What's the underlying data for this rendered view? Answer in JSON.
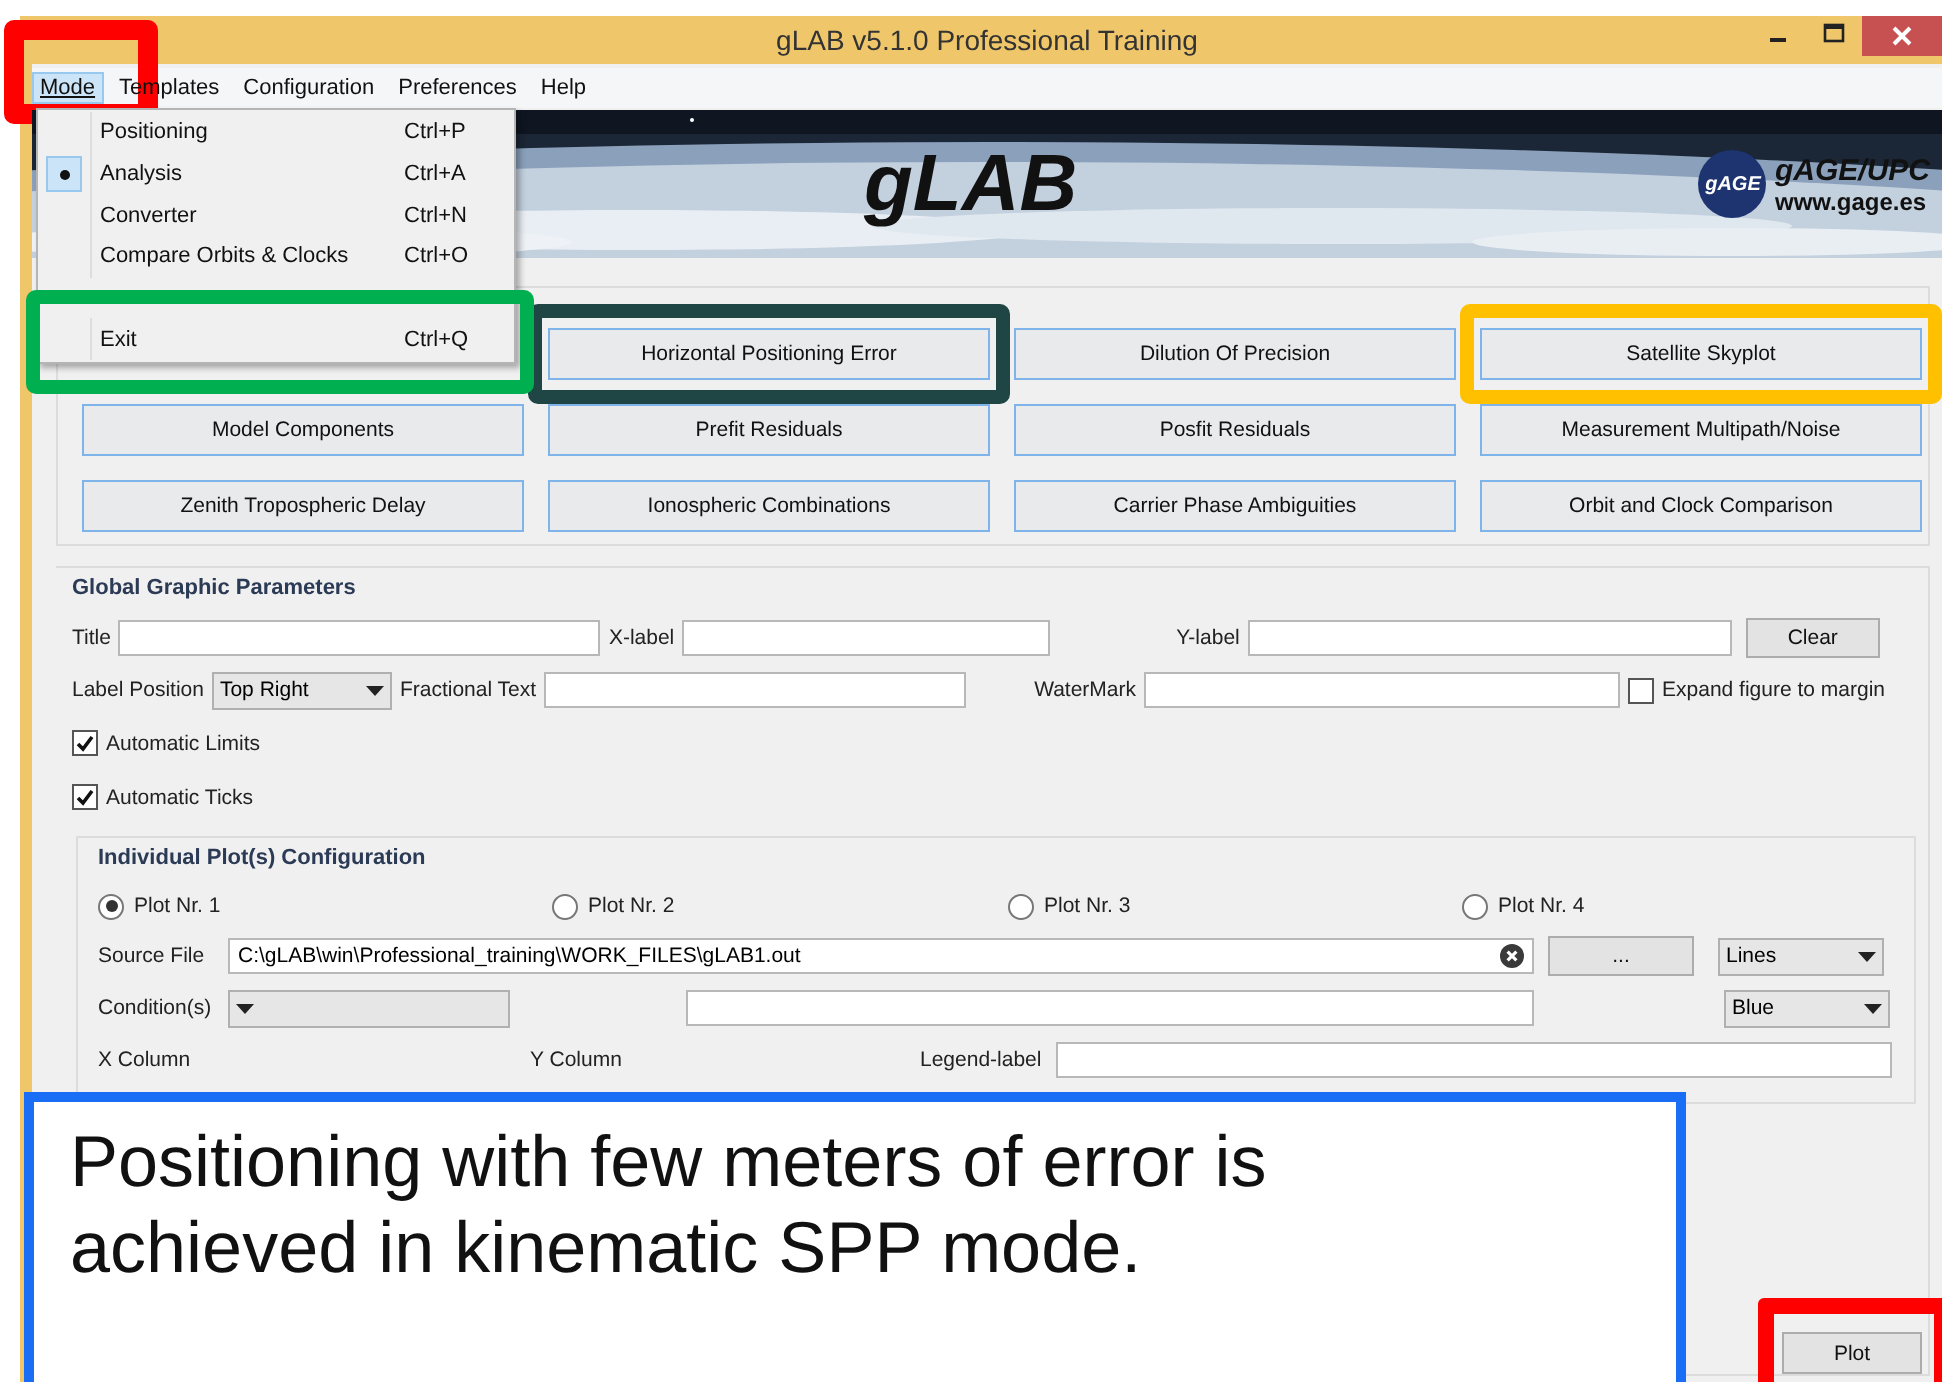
{
  "window": {
    "title": "gLAB v5.1.0 Professional Training"
  },
  "menu_bar": [
    {
      "label": "Mode",
      "selected": true,
      "highlight": {
        "color": "#ff0000"
      }
    },
    {
      "label": "Templates",
      "selected": false
    },
    {
      "label": "Configuration",
      "selected": false
    },
    {
      "label": "Preferences",
      "selected": false
    },
    {
      "label": "Help",
      "selected": false
    }
  ],
  "mode_menu": [
    {
      "label": "Positioning",
      "shortcut": "Ctrl+P",
      "checked": false
    },
    {
      "label": "Analysis",
      "shortcut": "Ctrl+A",
      "checked": true
    },
    {
      "label": "Converter",
      "shortcut": "Ctrl+N",
      "checked": false
    },
    {
      "label": "Compare Orbits & Clocks",
      "shortcut": "Ctrl+O",
      "checked": false
    },
    {
      "label": "Exit",
      "shortcut": "Ctrl+Q",
      "checked": false,
      "highlight": {
        "color": "#00b050"
      }
    }
  ],
  "banner": {
    "title": "gLAB",
    "logo_badge": "gAGE",
    "logo_name": "gAGE/UPC",
    "website": "www.gage.es"
  },
  "plot_buttons": [
    {
      "label": "Horizontal Positioning Error",
      "highlight": {
        "color": "#1f4545"
      }
    },
    {
      "label": "Dilution Of Precision"
    },
    {
      "label": "Satellite Skyplot",
      "highlight": {
        "color": "#ffc000"
      }
    },
    {
      "label": "Model Components"
    },
    {
      "label": "Prefit Residuals"
    },
    {
      "label": "Posfit Residuals"
    },
    {
      "label": "Measurement Multipath/Noise"
    },
    {
      "label": "Zenith Tropospheric Delay"
    },
    {
      "label": "Ionospheric Combinations"
    },
    {
      "label": "Carrier Phase Ambiguities"
    },
    {
      "label": "Orbit and Clock Comparison"
    }
  ],
  "global_parameters": {
    "heading": "Global Graphic Parameters",
    "title_label": "Title",
    "xlabel_label": "X-label",
    "ylabel_label": "Y-label",
    "clear_button": "Clear",
    "label_position_label": "Label Position",
    "label_position_value": "Top Right",
    "fractional_text_label": "Fractional Text",
    "watermark_label": "WaterMark",
    "expand": {
      "label": "Expand figure to margin",
      "checked": false
    },
    "checkboxes": [
      {
        "label": "Automatic Limits",
        "checked": true
      },
      {
        "label": "Automatic Ticks",
        "checked": true
      }
    ]
  },
  "individual": {
    "heading": "Individual Plot(s) Configuration",
    "plots": [
      {
        "label": "Plot Nr. 1",
        "selected": true
      },
      {
        "label": "Plot Nr. 2",
        "selected": false
      },
      {
        "label": "Plot Nr. 3",
        "selected": false
      },
      {
        "label": "Plot Nr. 4",
        "selected": false
      }
    ],
    "source_file_label": "Source File",
    "source_file_value": "C:\\gLAB\\win\\Professional_training\\WORK_FILES\\gLAB1.out",
    "browse_button": "...",
    "line_style": "Lines",
    "conditions_label": "Condition(s)",
    "color_value": "Blue",
    "x_column_label": "X Column",
    "y_column_label": "Y Column",
    "legend_label": "Legend-label"
  },
  "plot_button": {
    "label": "Plot",
    "highlight": {
      "color": "#ff0000"
    }
  },
  "callout": {
    "text": "Positioning with few meters of error is achieved in kinematic SPP mode."
  }
}
